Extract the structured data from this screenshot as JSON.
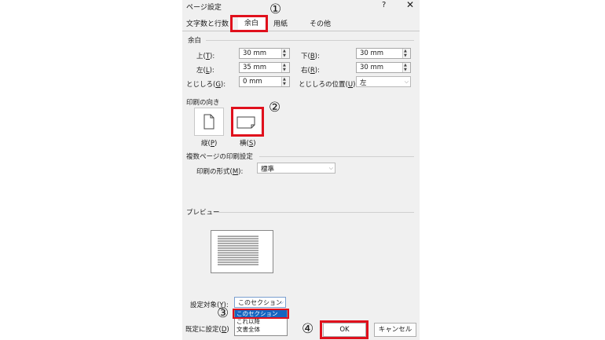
{
  "dialog": {
    "title": "ページ設定",
    "help": "?",
    "close": "✕"
  },
  "tabs": [
    {
      "label": "文字数と行数"
    },
    {
      "label": "余白"
    },
    {
      "label": "用紙"
    },
    {
      "label": "その他"
    }
  ],
  "margins": {
    "section": "余白",
    "top": {
      "label_pre": "上(",
      "key": "T",
      "label_post": "):",
      "value": "30 mm"
    },
    "bottom": {
      "label_pre": "下(",
      "key": "B",
      "label_post": "):",
      "value": "30 mm"
    },
    "left": {
      "label_pre": "左(",
      "key": "L",
      "label_post": "):",
      "value": "35 mm"
    },
    "right": {
      "label_pre": "右(",
      "key": "R",
      "label_post": "):",
      "value": "30 mm"
    },
    "gutter": {
      "label_pre": "とじしろ(",
      "key": "G",
      "label_post": "):",
      "value": "0 mm"
    },
    "gutter_pos": {
      "label_pre": "とじしろの位置(",
      "key": "U",
      "label_post": "):",
      "value": "左"
    }
  },
  "orientation": {
    "section": "印刷の向き",
    "portrait": {
      "label_pre": "縦(",
      "key": "P",
      "label_post": ")"
    },
    "landscape": {
      "label_pre": "横(",
      "key": "S",
      "label_post": ")"
    }
  },
  "pages": {
    "section": "複数ページの印刷設定",
    "label_pre": "印刷の形式(",
    "key": "M",
    "label_post": "):",
    "value": "標準"
  },
  "preview": {
    "section": "プレビュー"
  },
  "apply": {
    "label_pre": "設定対象(",
    "key": "Y",
    "label_post": "):",
    "value": "このセクション",
    "options": [
      "このセクション",
      "これ以降",
      "文書全体"
    ]
  },
  "buttons": {
    "default_pre": "既定に設定(",
    "default_key": "D",
    "default_post": ")",
    "ok": "OK",
    "cancel": "キャンセル"
  },
  "callouts": {
    "c1": "①",
    "c2": "②",
    "c3": "③",
    "c4": "④"
  },
  "colors": {
    "highlight": "#e0101c",
    "selection": "#1565c0"
  }
}
